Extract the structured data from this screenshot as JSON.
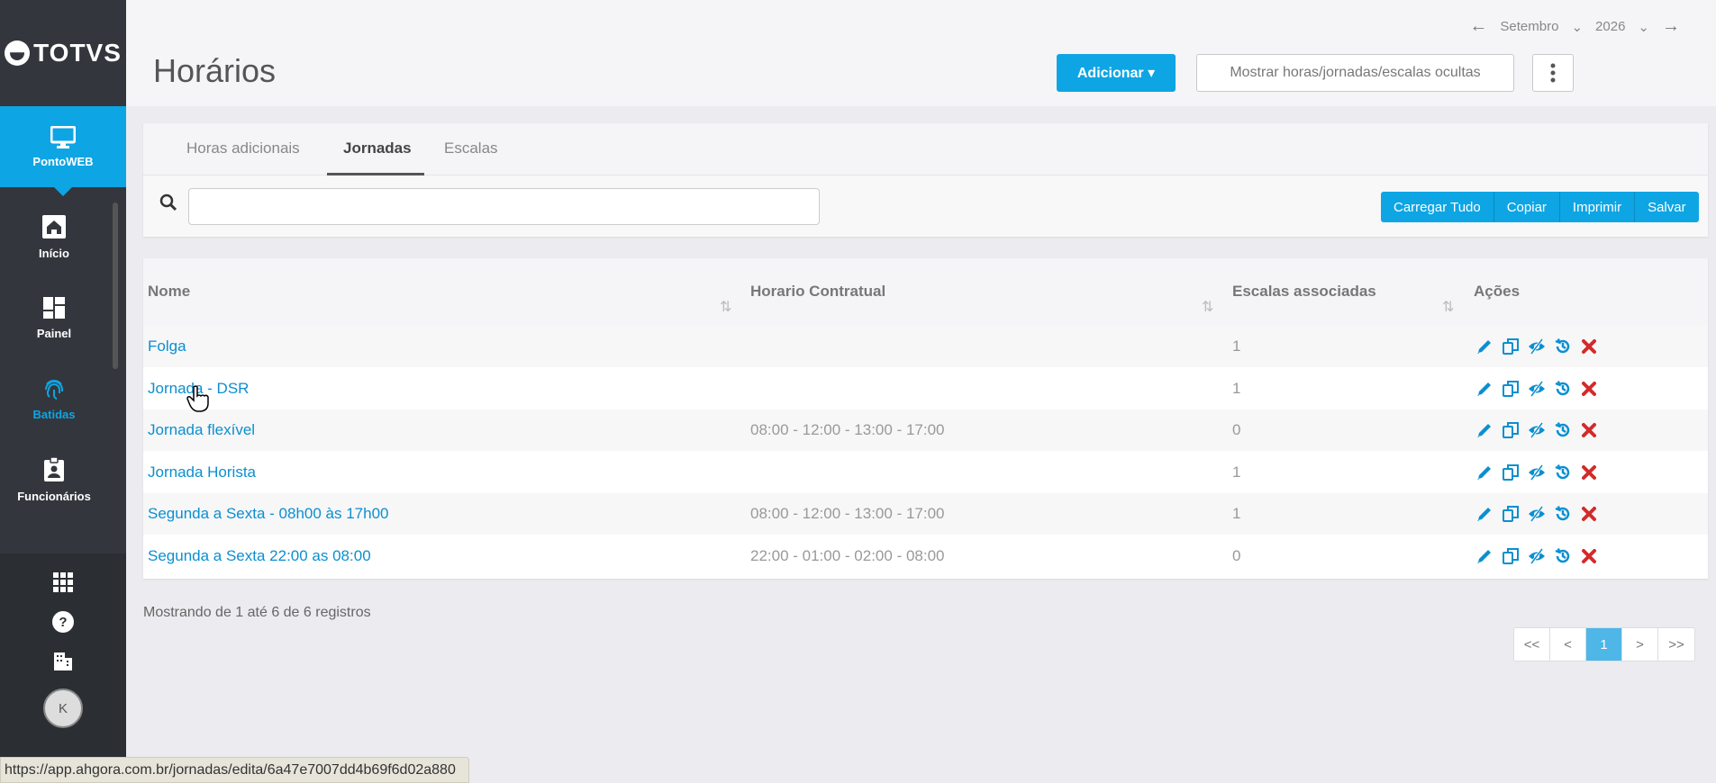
{
  "sidebar": {
    "logo_text": "TOTVS",
    "app_label": "PontoWEB",
    "items": [
      {
        "label": "Início",
        "icon": "home-icon"
      },
      {
        "label": "Painel",
        "icon": "dashboard-icon"
      },
      {
        "label": "Batidas",
        "icon": "fingerprint-icon"
      },
      {
        "label": "Funcionários",
        "icon": "badge-icon"
      }
    ],
    "avatar_initial": "K"
  },
  "header": {
    "title": "Horários",
    "month": "Setembro",
    "year": "2026",
    "add_label": "Adicionar",
    "hidden_label": "Mostrar horas/jornadas/escalas ocultas"
  },
  "tabs": [
    {
      "label": "Horas adicionais"
    },
    {
      "label": "Jornadas"
    },
    {
      "label": "Escalas"
    }
  ],
  "active_tab": "Jornadas",
  "toolbar": {
    "search_value": "",
    "buttons": [
      "Carregar Tudo",
      "Copiar",
      "Imprimir",
      "Salvar"
    ]
  },
  "table": {
    "columns": [
      "Nome",
      "Horario Contratual",
      "Escalas associadas",
      "Ações"
    ],
    "rows": [
      {
        "nome": "Folga",
        "horario": "",
        "escalas": "1"
      },
      {
        "nome": "Jornada - DSR",
        "horario": "",
        "escalas": "1"
      },
      {
        "nome": "Jornada flexível",
        "horario": "08:00 - 12:00 - 13:00 - 17:00",
        "escalas": "0"
      },
      {
        "nome": "Jornada Horista",
        "horario": "",
        "escalas": "1"
      },
      {
        "nome": "Segunda a Sexta - 08h00 às 17h00",
        "horario": "08:00 - 12:00 - 13:00 - 17:00",
        "escalas": "1"
      },
      {
        "nome": "Segunda a Sexta 22:00 as 08:00",
        "horario": "22:00 - 01:00 - 02:00 - 08:00",
        "escalas": "0"
      }
    ]
  },
  "footer": {
    "record_info": "Mostrando de 1 até 6 de 6 registros",
    "pagination": [
      "<<",
      "<",
      "1",
      ">",
      ">>"
    ],
    "current_page": "1"
  },
  "status_url": "https://app.ahgora.com.br/jornadas/edita/6a47e7007dd4b69f6d02a880",
  "colors": {
    "accent": "#0ea5e4",
    "sidebar_bg": "#33373d",
    "link": "#0b8fd0",
    "delete": "#d42a2a"
  }
}
